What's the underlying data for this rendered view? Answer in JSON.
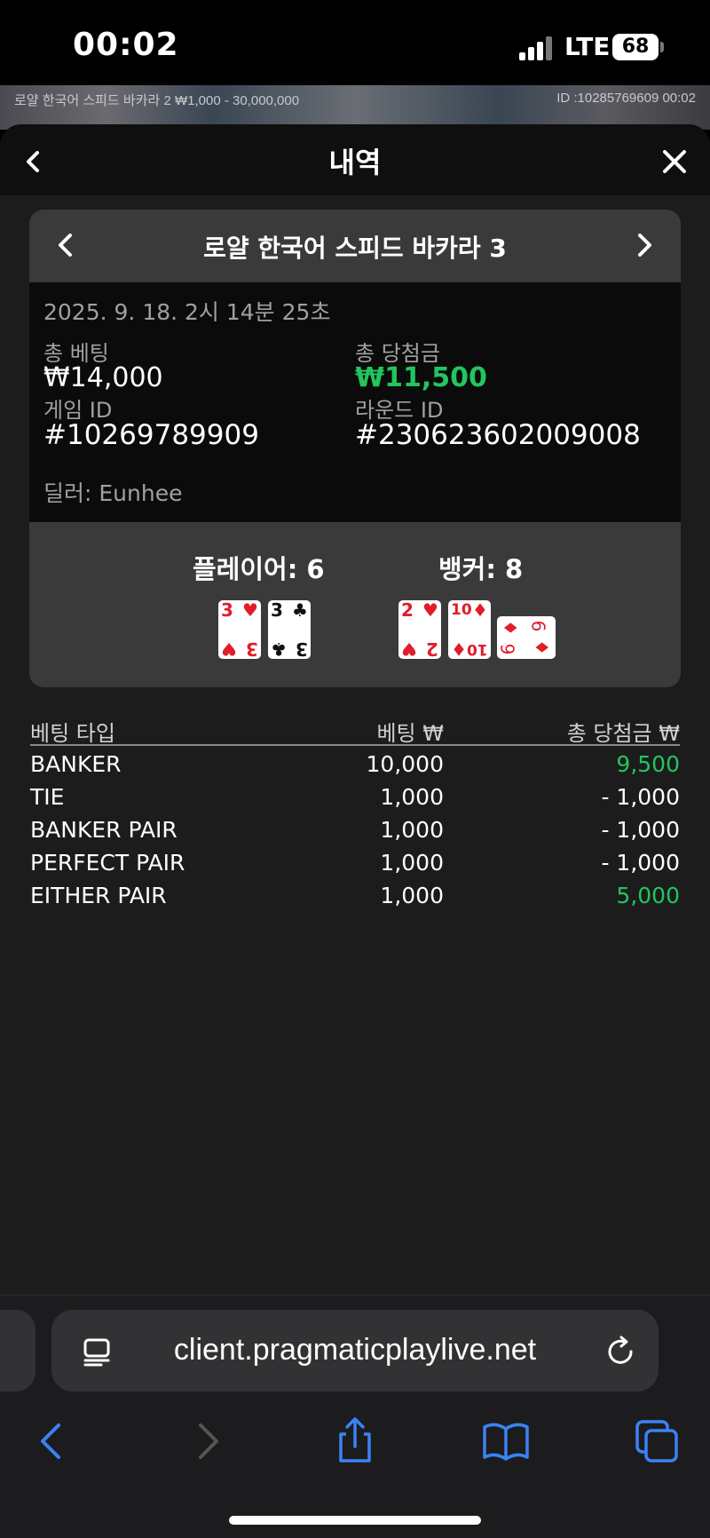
{
  "status_bar": {
    "time": "00:02",
    "network": "LTE",
    "battery": "68"
  },
  "game_strip": {
    "left_text": "로얄 한국어 스피드 바카라 2 ₩1,000 - 30,000,000",
    "right_text": "ID :10285769609 00:02"
  },
  "sheet": {
    "title": "내역"
  },
  "history": {
    "game_name": "로얄 한국어 스피드 바카라 3",
    "date": "2025. 9. 18. 2시 14분 25초",
    "total_bet_label": "총 베팅",
    "total_bet": "₩14,000",
    "total_win_label": "총 당첨금",
    "total_win": "₩11,500",
    "game_id_label": "게임 ID",
    "game_id": "#10269789909",
    "round_id_label": "라운드 ID",
    "round_id": "#230623602009008",
    "dealer": "딜러: Eunhee"
  },
  "result": {
    "player_label": "플레이어: 6",
    "banker_label": "뱅커: 8",
    "player_cards": [
      {
        "rank": "3",
        "suit": "♥",
        "color": "red"
      },
      {
        "rank": "3",
        "suit": "♣",
        "color": "black"
      }
    ],
    "banker_cards": [
      {
        "rank": "2",
        "suit": "♥",
        "color": "red"
      },
      {
        "rank": "10",
        "suit": "♦",
        "color": "red"
      },
      {
        "rank": "6",
        "suit": "♦",
        "color": "red",
        "rotated": true
      }
    ]
  },
  "bets": {
    "headers": [
      "베팅 타입",
      "베팅 ₩",
      "총 당첨금 ₩"
    ],
    "rows": [
      {
        "type": "BANKER",
        "bet": "10,000",
        "win": "9,500",
        "positive": true
      },
      {
        "type": "TIE",
        "bet": "1,000",
        "win": "- 1,000",
        "positive": false
      },
      {
        "type": "BANKER PAIR",
        "bet": "1,000",
        "win": "- 1,000",
        "positive": false
      },
      {
        "type": "PERFECT PAIR",
        "bet": "1,000",
        "win": "- 1,000",
        "positive": false
      },
      {
        "type": "EITHER PAIR",
        "bet": "1,000",
        "win": "5,000",
        "positive": true
      }
    ]
  },
  "browser": {
    "url": "client.pragmaticplaylive.net"
  },
  "colors": {
    "win_green": "#22c55e",
    "sheet_bg": "#1c1c1c",
    "panel_gray": "#3a3a3a",
    "ios_blue": "#3b82f6"
  },
  "icons": [
    "chevron-left-icon",
    "close-icon",
    "chevron-right-icon",
    "reader-icon",
    "reload-icon",
    "share-icon",
    "bookmarks-icon",
    "tabs-icon"
  ]
}
